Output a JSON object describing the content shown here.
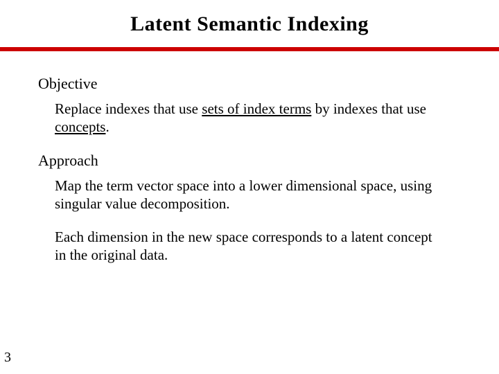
{
  "title": "Latent Semantic Indexing",
  "sections": {
    "objective": {
      "heading": "Objective",
      "p1a": "Replace indexes that use ",
      "p1u1": "sets of index terms",
      "p1b": " by indexes that use ",
      "p1u2": "concepts",
      "p1c": "."
    },
    "approach": {
      "heading": "Approach",
      "p1": "Map the term vector space into a lower dimensional space, using singular value decomposition.",
      "p2": "Each dimension in the new space corresponds to a latent concept in the original data."
    }
  },
  "page_number": "3"
}
